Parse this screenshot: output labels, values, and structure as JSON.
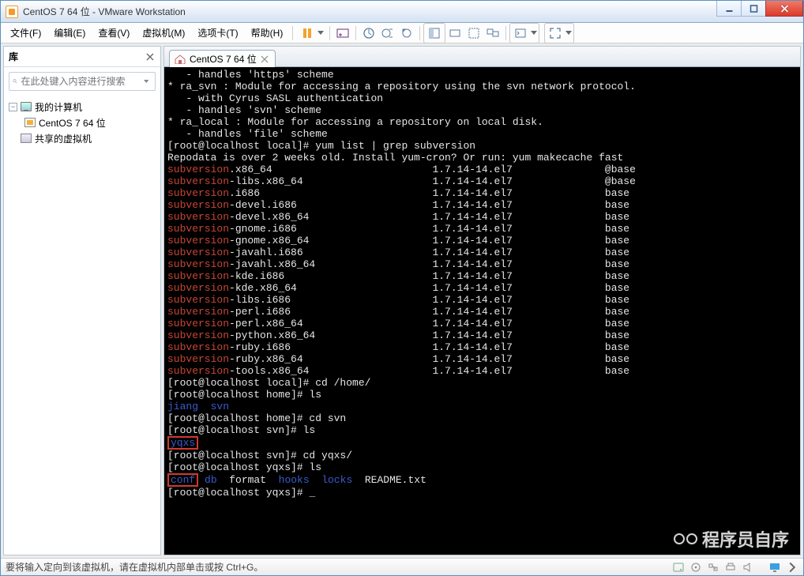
{
  "window": {
    "title": "CentOS 7 64 位 - VMware Workstation"
  },
  "menu": {
    "items": [
      "文件(F)",
      "编辑(E)",
      "查看(V)",
      "虚拟机(M)",
      "选项卡(T)",
      "帮助(H)"
    ]
  },
  "sidebar": {
    "title": "库",
    "search_placeholder": "在此处键入内容进行搜索",
    "root": "我的计算机",
    "vm": "CentOS 7 64 位",
    "shared": "共享的虚拟机"
  },
  "tab": {
    "label": "CentOS 7 64 位"
  },
  "terminal": {
    "lines": [
      {
        "segs": [
          {
            "c": "w",
            "t": "   - handles 'https' scheme"
          }
        ]
      },
      {
        "segs": [
          {
            "c": "w",
            "t": "* ra_svn : Module for accessing a repository using the svn network protocol."
          }
        ]
      },
      {
        "segs": [
          {
            "c": "w",
            "t": "   - with Cyrus SASL authentication"
          }
        ]
      },
      {
        "segs": [
          {
            "c": "w",
            "t": "   - handles 'svn' scheme"
          }
        ]
      },
      {
        "segs": [
          {
            "c": "w",
            "t": "* ra_local : Module for accessing a repository on local disk."
          }
        ]
      },
      {
        "segs": [
          {
            "c": "w",
            "t": "   - handles 'file' scheme"
          }
        ]
      },
      {
        "segs": [
          {
            "c": "w",
            "t": ""
          }
        ]
      },
      {
        "segs": [
          {
            "c": "w",
            "t": "[root@localhost local]# yum list | grep subversion"
          }
        ]
      },
      {
        "segs": [
          {
            "c": "w",
            "t": "Repodata is over 2 weeks old. Install yum-cron? Or run: yum makecache fast"
          }
        ]
      },
      {
        "segs": [
          {
            "c": "r",
            "t": "subversion"
          },
          {
            "c": "w",
            "t": ".x86_64                          1.7.14-14.el7               @base"
          }
        ]
      },
      {
        "segs": [
          {
            "c": "r",
            "t": "subversion"
          },
          {
            "c": "w",
            "t": "-libs.x86_64                     1.7.14-14.el7               @base"
          }
        ]
      },
      {
        "segs": [
          {
            "c": "r",
            "t": "subversion"
          },
          {
            "c": "w",
            "t": ".i686                            1.7.14-14.el7               base"
          }
        ]
      },
      {
        "segs": [
          {
            "c": "r",
            "t": "subversion"
          },
          {
            "c": "w",
            "t": "-devel.i686                      1.7.14-14.el7               base"
          }
        ]
      },
      {
        "segs": [
          {
            "c": "r",
            "t": "subversion"
          },
          {
            "c": "w",
            "t": "-devel.x86_64                    1.7.14-14.el7               base"
          }
        ]
      },
      {
        "segs": [
          {
            "c": "r",
            "t": "subversion"
          },
          {
            "c": "w",
            "t": "-gnome.i686                      1.7.14-14.el7               base"
          }
        ]
      },
      {
        "segs": [
          {
            "c": "r",
            "t": "subversion"
          },
          {
            "c": "w",
            "t": "-gnome.x86_64                    1.7.14-14.el7               base"
          }
        ]
      },
      {
        "segs": [
          {
            "c": "r",
            "t": "subversion"
          },
          {
            "c": "w",
            "t": "-javahl.i686                     1.7.14-14.el7               base"
          }
        ]
      },
      {
        "segs": [
          {
            "c": "r",
            "t": "subversion"
          },
          {
            "c": "w",
            "t": "-javahl.x86_64                   1.7.14-14.el7               base"
          }
        ]
      },
      {
        "segs": [
          {
            "c": "r",
            "t": "subversion"
          },
          {
            "c": "w",
            "t": "-kde.i686                        1.7.14-14.el7               base"
          }
        ]
      },
      {
        "segs": [
          {
            "c": "r",
            "t": "subversion"
          },
          {
            "c": "w",
            "t": "-kde.x86_64                      1.7.14-14.el7               base"
          }
        ]
      },
      {
        "segs": [
          {
            "c": "r",
            "t": "subversion"
          },
          {
            "c": "w",
            "t": "-libs.i686                       1.7.14-14.el7               base"
          }
        ]
      },
      {
        "segs": [
          {
            "c": "r",
            "t": "subversion"
          },
          {
            "c": "w",
            "t": "-perl.i686                       1.7.14-14.el7               base"
          }
        ]
      },
      {
        "segs": [
          {
            "c": "r",
            "t": "subversion"
          },
          {
            "c": "w",
            "t": "-perl.x86_64                     1.7.14-14.el7               base"
          }
        ]
      },
      {
        "segs": [
          {
            "c": "r",
            "t": "subversion"
          },
          {
            "c": "w",
            "t": "-python.x86_64                   1.7.14-14.el7               base"
          }
        ]
      },
      {
        "segs": [
          {
            "c": "r",
            "t": "subversion"
          },
          {
            "c": "w",
            "t": "-ruby.i686                       1.7.14-14.el7               base"
          }
        ]
      },
      {
        "segs": [
          {
            "c": "r",
            "t": "subversion"
          },
          {
            "c": "w",
            "t": "-ruby.x86_64                     1.7.14-14.el7               base"
          }
        ]
      },
      {
        "segs": [
          {
            "c": "r",
            "t": "subversion"
          },
          {
            "c": "w",
            "t": "-tools.x86_64                    1.7.14-14.el7               base"
          }
        ]
      },
      {
        "segs": [
          {
            "c": "w",
            "t": "[root@localhost local]# cd /home/"
          }
        ]
      },
      {
        "segs": [
          {
            "c": "w",
            "t": "[root@localhost home]# ls"
          }
        ]
      },
      {
        "segs": [
          {
            "c": "b",
            "t": "jiang  svn"
          }
        ]
      },
      {
        "segs": [
          {
            "c": "w",
            "t": "[root@localhost home]# cd svn"
          }
        ]
      },
      {
        "segs": [
          {
            "c": "w",
            "t": "[root@localhost svn]# ls"
          }
        ]
      },
      {
        "segs": [
          {
            "c": "b",
            "t": "yqxs",
            "box": true
          }
        ]
      },
      {
        "segs": [
          {
            "c": "w",
            "t": "[root@localhost svn]# cd yqxs/"
          }
        ]
      },
      {
        "segs": [
          {
            "c": "w",
            "t": "[root@localhost yqxs]# ls"
          }
        ]
      },
      {
        "segs": [
          {
            "c": "b",
            "t": "conf",
            "box": true
          },
          {
            "c": "b",
            "t": " db"
          },
          {
            "c": "w",
            "t": "  format  "
          },
          {
            "c": "b",
            "t": "hooks  locks"
          },
          {
            "c": "w",
            "t": "  README.txt"
          }
        ]
      },
      {
        "segs": [
          {
            "c": "w",
            "t": "[root@localhost yqxs]# "
          },
          {
            "c": "cur",
            "t": "_"
          }
        ]
      }
    ]
  },
  "status": {
    "text": "要将输入定向到该虚拟机，请在虚拟机内部单击或按 Ctrl+G。"
  },
  "watermark": {
    "text": "程序员自序"
  }
}
